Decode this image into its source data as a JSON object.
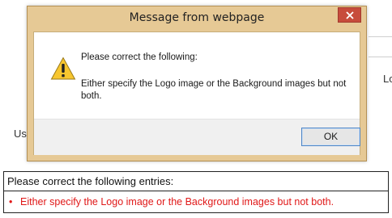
{
  "background_page": {
    "left_fragment": "Us",
    "right_fragment": "Lo"
  },
  "dialog": {
    "title": "Message from webpage",
    "close_icon": "close-icon",
    "warning_icon": "warning-icon",
    "heading": "Please correct the following:",
    "body": "Either specify the Logo image or the Background images but not both.",
    "ok_label": "OK"
  },
  "error_summary": {
    "header": "Please correct the following entries:",
    "items": [
      "Either specify the Logo image or the Background images but not both."
    ],
    "item_color": "#e01818"
  },
  "colors": {
    "dialog_frame": "#e6c995",
    "close_button": "#c74c3c"
  }
}
